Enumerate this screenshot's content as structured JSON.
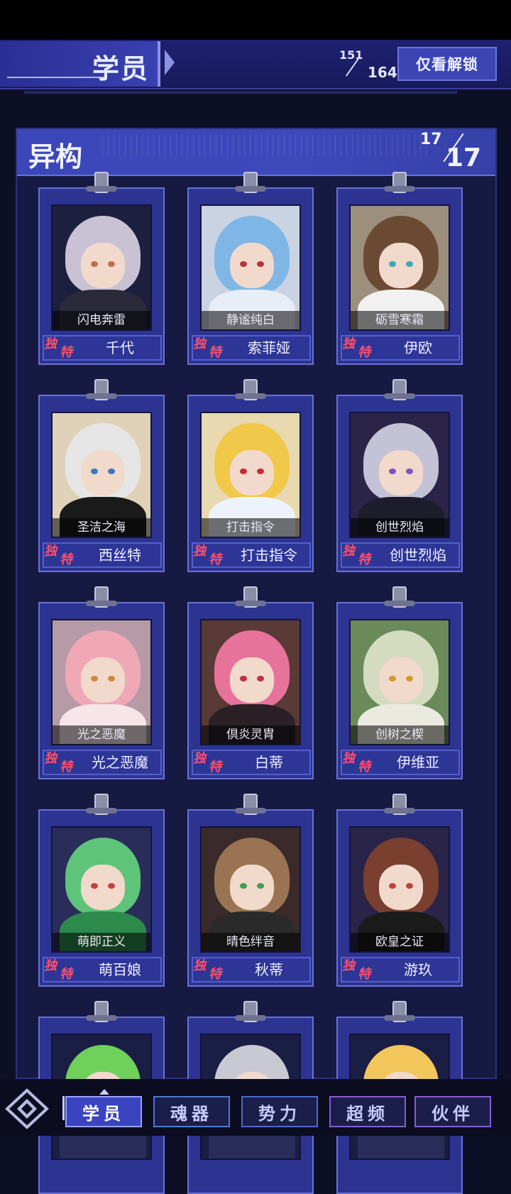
{
  "header": {
    "title": "学员",
    "count_current": "151",
    "count_total": "164",
    "unlock_filter_label": "仅看解锁"
  },
  "section": {
    "title": "异构",
    "count_current": "17",
    "count_total": "17"
  },
  "badge": {
    "line1": "独",
    "line2": "特"
  },
  "cards": [
    {
      "skin": "闪电奔雷",
      "name": "千代",
      "hair": "#c8c2d4",
      "body": "#2a2a3a",
      "bg": "#1c1f3e",
      "eye": "#c46b4a"
    },
    {
      "skin": "静谧纯白",
      "name": "索菲娅",
      "hair": "#7fb6e6",
      "body": "#e8eef8",
      "bg": "#c9d3e2",
      "eye": "#b6333c"
    },
    {
      "skin": "砺雪寒霜",
      "name": "伊欧",
      "hair": "#6b4a34",
      "body": "#f1f1f1",
      "bg": "#9c8f7c",
      "eye": "#3aa8b8"
    },
    {
      "skin": "圣洁之海",
      "name": "西丝特",
      "hair": "#e6e6e6",
      "body": "#1a1a1a",
      "bg": "#e0d2b8",
      "eye": "#3b78c2"
    },
    {
      "skin": "打击指令",
      "name": "打击指令",
      "hair": "#f0c84a",
      "body": "#eef2fb",
      "bg": "#e8d9b0",
      "eye": "#c92a32"
    },
    {
      "skin": "创世烈焰",
      "name": "创世烈焰",
      "hair": "#c4c2d6",
      "body": "#1c1c2a",
      "bg": "#2b2448",
      "eye": "#7b55b8"
    },
    {
      "skin": "光之恶魔",
      "name": "光之恶魔",
      "hair": "#f1a8b6",
      "body": "#f6e6ea",
      "bg": "#b69aa6",
      "eye": "#d0883c"
    },
    {
      "skin": "倶炎灵胄",
      "name": "白蒂",
      "hair": "#e8739a",
      "body": "#2a2026",
      "bg": "#5a3a36",
      "eye": "#c42f3d"
    },
    {
      "skin": "创树之楔",
      "name": "伊维亚",
      "hair": "#d4dcc0",
      "body": "#eaeae0",
      "bg": "#6a8a5a",
      "eye": "#d49a2c"
    },
    {
      "skin": "萌即正义",
      "name": "萌百娘",
      "hair": "#5ec47a",
      "body": "#2c8a4a",
      "bg": "#2a2d5a",
      "eye": "#c2433a"
    },
    {
      "skin": "晴色绊音",
      "name": "秋蒂",
      "hair": "#9a7452",
      "body": "#2a2a2a",
      "bg": "#3a2a2c",
      "eye": "#3aa04a"
    },
    {
      "skin": "欧皇之证",
      "name": "游玖",
      "hair": "#7a3f2e",
      "body": "#1a1a1a",
      "bg": "#2a2448",
      "eye": "#c2433a"
    },
    {
      "skin": "",
      "name": "",
      "hair": "#6fd05a",
      "body": "#2a2d5a",
      "bg": "#1a1d44",
      "eye": "#2a2a2a"
    },
    {
      "skin": "",
      "name": "",
      "hair": "#c9c9d4",
      "body": "#2a2d5a",
      "bg": "#1a1d44",
      "eye": "#2a2a2a"
    },
    {
      "skin": "",
      "name": "",
      "hair": "#f2c65a",
      "body": "#2a2d5a",
      "bg": "#1a1d44",
      "eye": "#2a2a2a"
    }
  ],
  "bottom_nav": {
    "tabs": [
      {
        "label": "学员",
        "active": true,
        "color": "#9aa2ff"
      },
      {
        "label": "魂器",
        "active": false,
        "color": "#4a7ad6"
      },
      {
        "label": "势力",
        "active": false,
        "color": "#4a6ad0"
      },
      {
        "label": "超频",
        "active": false,
        "color": "#8a5ad6"
      },
      {
        "label": "伙伴",
        "active": false,
        "color": "#8a5ad6"
      }
    ]
  }
}
